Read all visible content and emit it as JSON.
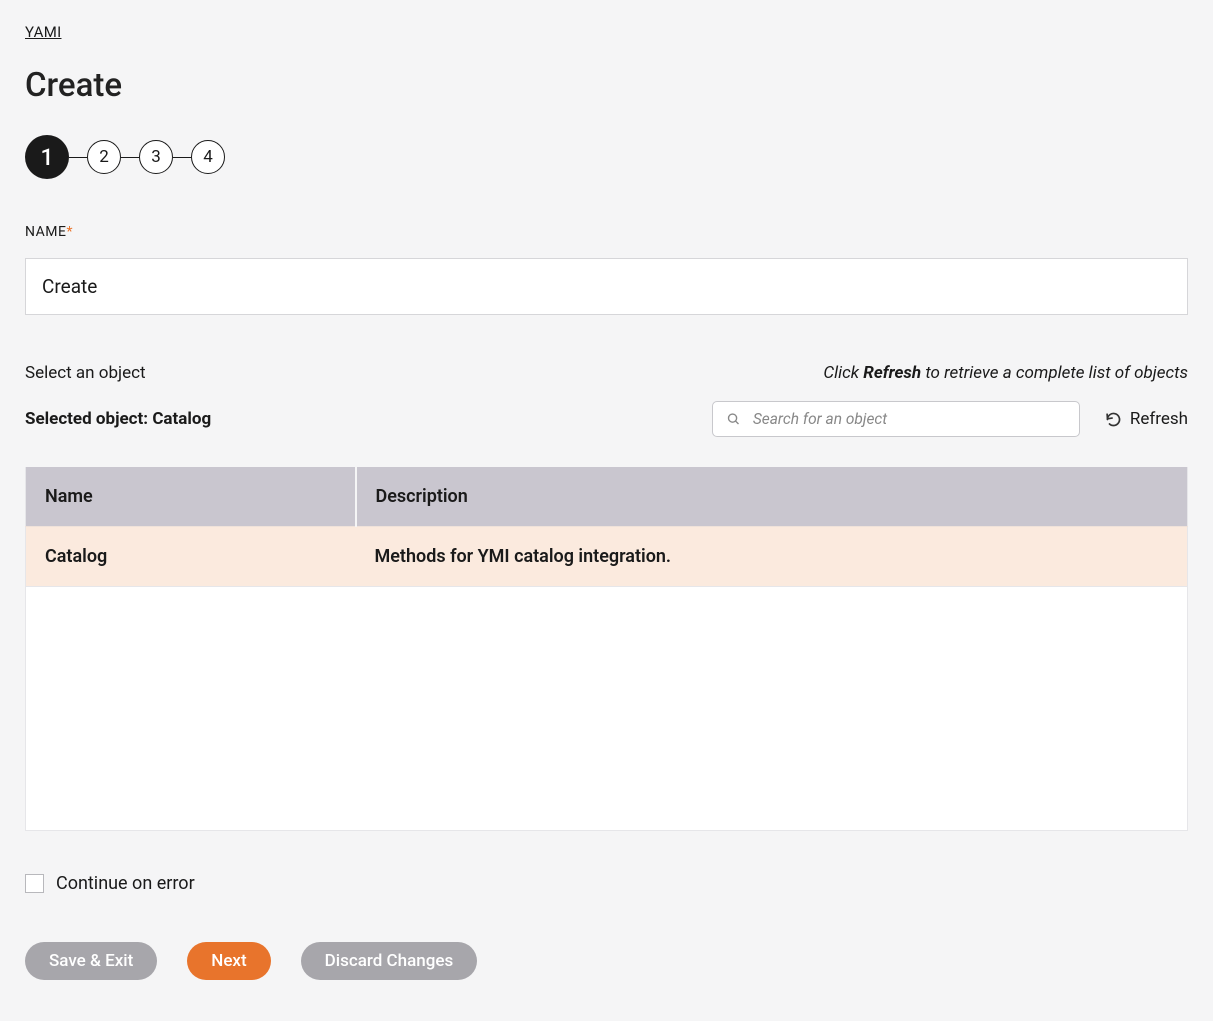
{
  "breadcrumb": "YAMI",
  "page_title": "Create",
  "stepper": {
    "steps": [
      "1",
      "2",
      "3",
      "4"
    ],
    "active_index": 0
  },
  "name_field": {
    "label": "NAME",
    "required_mark": "*",
    "value": "Create"
  },
  "object_section": {
    "select_label": "Select an object",
    "refresh_hint_prefix": "Click ",
    "refresh_hint_strong": "Refresh",
    "refresh_hint_suffix": " to retrieve a complete list of objects",
    "selected_prefix": "Selected object: ",
    "selected_value": "Catalog",
    "search_placeholder": "Search for an object",
    "refresh_button": "Refresh",
    "columns": {
      "name": "Name",
      "description": "Description"
    },
    "rows": [
      {
        "name": "Catalog",
        "description": "Methods for YMI catalog integration.",
        "selected": true
      }
    ]
  },
  "continue_on_error": {
    "label": "Continue on error",
    "checked": false
  },
  "buttons": {
    "save_exit": "Save & Exit",
    "next": "Next",
    "discard": "Discard Changes"
  }
}
